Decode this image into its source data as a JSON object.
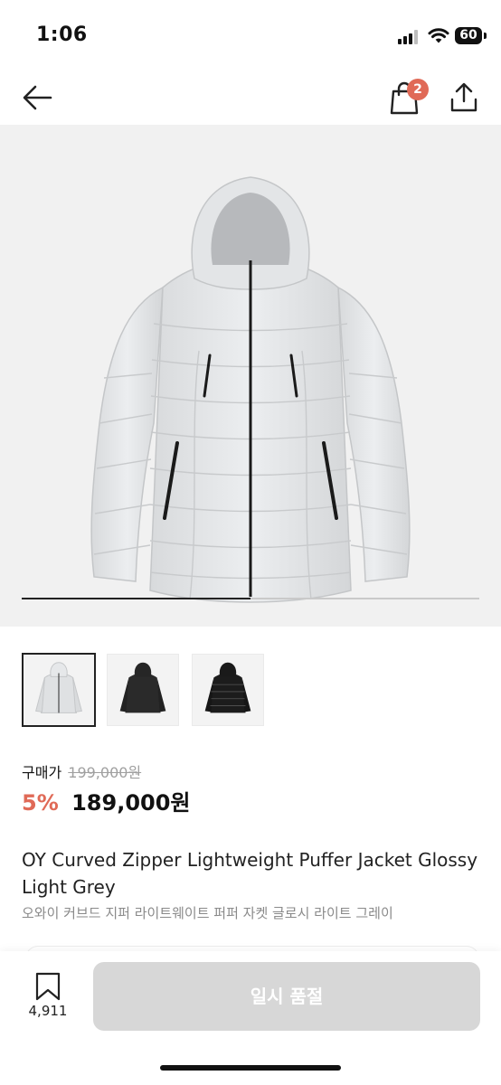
{
  "status_bar": {
    "time": "1:06",
    "battery": "60"
  },
  "nav": {
    "cart_count": "2"
  },
  "gallery": {
    "progress_fraction": 0.5,
    "thumbnail_colors": [
      "light-grey",
      "black-matte",
      "black-glossy"
    ],
    "selected_index": 0
  },
  "pricing": {
    "label": "구매가",
    "original_price": "199,000원",
    "discount": "5%",
    "price": "189,000원"
  },
  "product": {
    "title_en": "OY Curved Zipper Lightweight Puffer Jacket Glossy Light Grey",
    "title_ko": "오와이 커브드 지퍼 라이트웨이트 퍼퍼 자켓 글로시 라이트 그레이"
  },
  "bottom_bar": {
    "bookmark_count": "4,911",
    "buy_button_label": "일시 품절"
  },
  "colors": {
    "accent": "#e06a57",
    "disabled_button": "#d7d7d7",
    "hero_bg": "#f1f1f1"
  },
  "icons": [
    "back-arrow-icon",
    "shopping-bag-icon",
    "share-icon",
    "bookmark-icon"
  ]
}
